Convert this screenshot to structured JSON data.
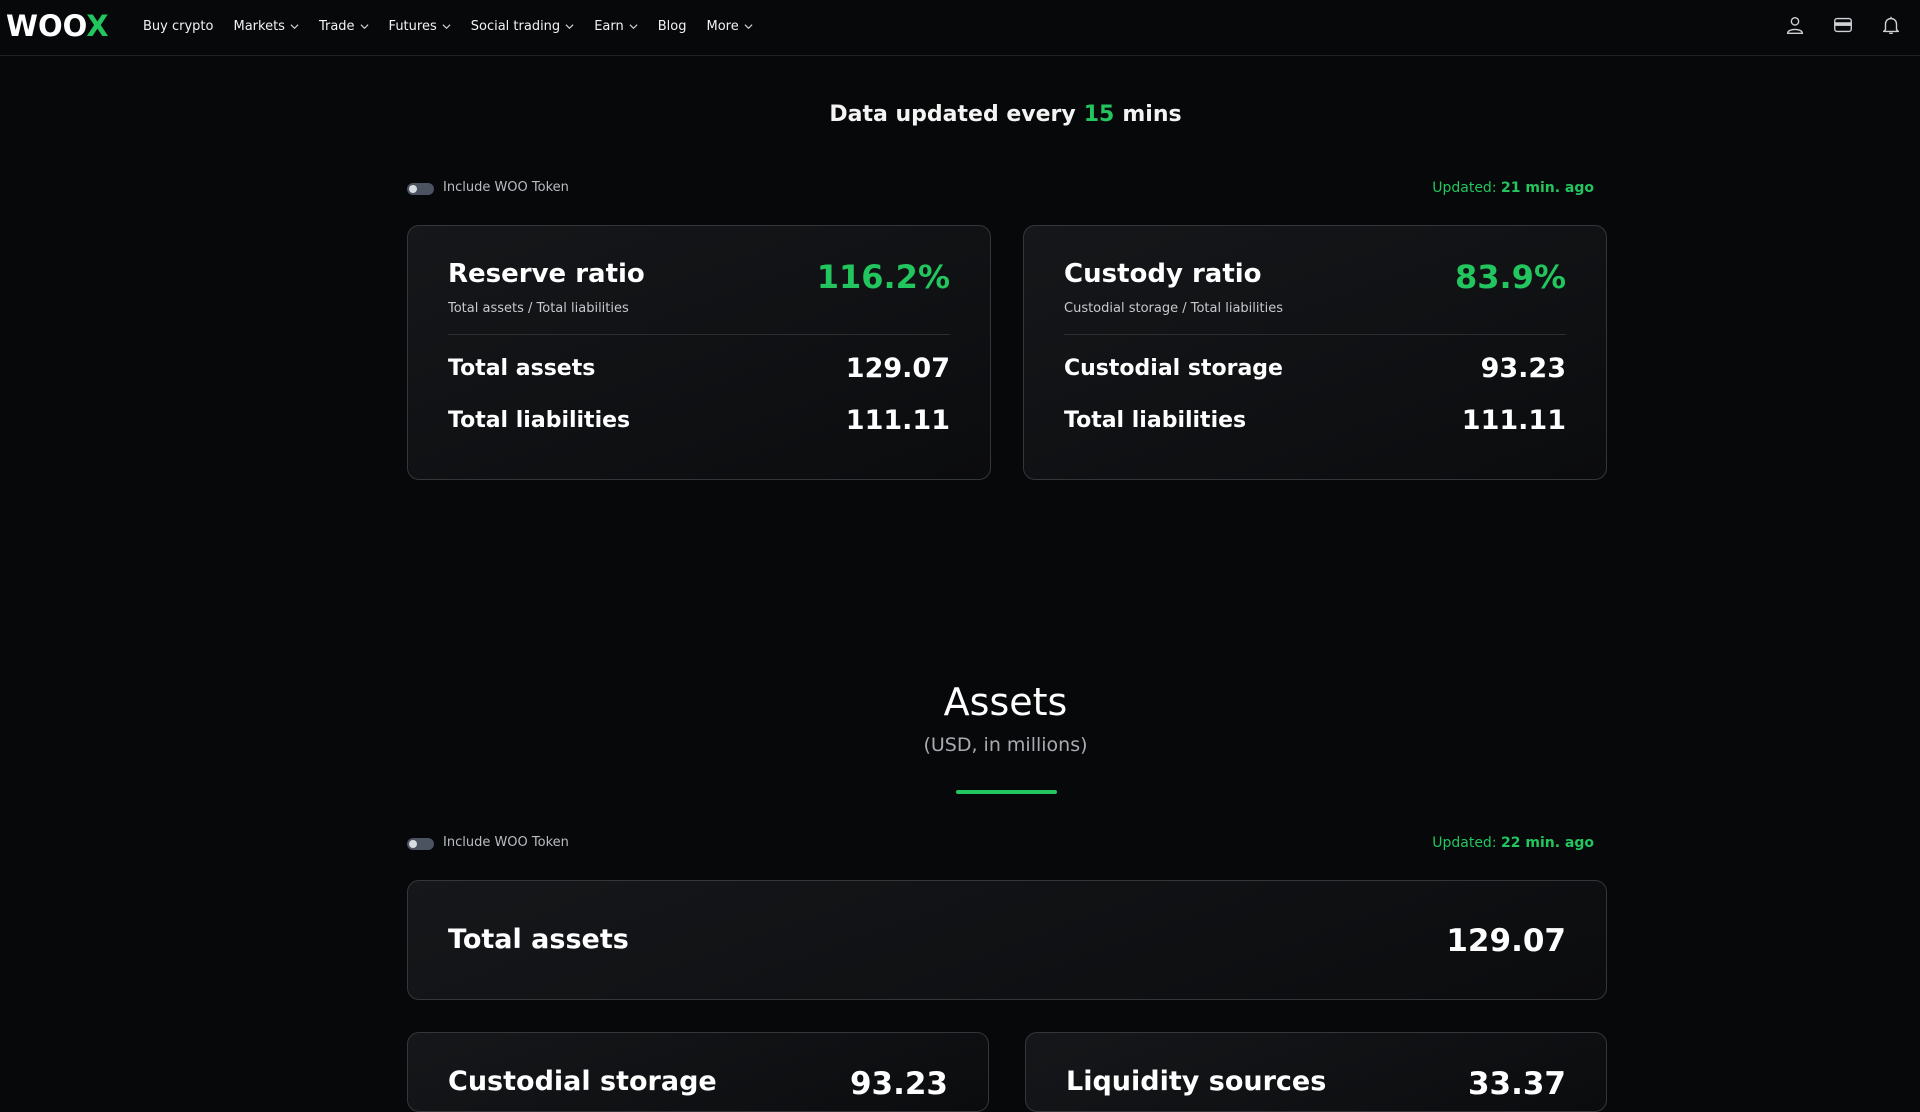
{
  "nav": {
    "logo_main": "WOO",
    "logo_accent": "X",
    "items": [
      {
        "label": "Buy crypto",
        "dropdown": false
      },
      {
        "label": "Markets",
        "dropdown": true
      },
      {
        "label": "Trade",
        "dropdown": true
      },
      {
        "label": "Futures",
        "dropdown": true
      },
      {
        "label": "Social trading",
        "dropdown": true
      },
      {
        "label": "Earn",
        "dropdown": true
      },
      {
        "label": "Blog",
        "dropdown": false
      },
      {
        "label": "More",
        "dropdown": true
      }
    ],
    "icons": [
      "user-icon",
      "wallet-icon",
      "bell-icon"
    ]
  },
  "headline": {
    "prefix": "Data updated every",
    "number": "15",
    "suffix": "mins"
  },
  "reserve_section": {
    "toggle_label": "Include WOO Token",
    "updated_prefix": "Updated:",
    "updated_value": "21 min. ago",
    "cards": [
      {
        "title": "Reserve ratio",
        "subtitle": "Total assets / Total liabilities",
        "ratio": "116.2%",
        "rows": [
          {
            "label": "Total assets",
            "value": "129.07"
          },
          {
            "label": "Total liabilities",
            "value": "111.11"
          }
        ]
      },
      {
        "title": "Custody ratio",
        "subtitle": "Custodial storage / Total liabilities",
        "ratio": "83.9%",
        "rows": [
          {
            "label": "Custodial storage",
            "value": "93.23"
          },
          {
            "label": "Total liabilities",
            "value": "111.11"
          }
        ]
      }
    ]
  },
  "assets_section": {
    "title": "Assets",
    "subtitle": "(USD, in millions)",
    "toggle_label": "Include WOO Token",
    "updated_prefix": "Updated:",
    "updated_value": "22 min. ago",
    "total": {
      "label": "Total assets",
      "value": "129.07"
    },
    "breakdown": [
      {
        "label": "Custodial storage",
        "value": "93.23"
      },
      {
        "label": "Liquidity sources",
        "value": "33.37"
      }
    ]
  },
  "colors": {
    "accent": "#22c55e",
    "background": "#07080a",
    "card_border": "#33363b"
  }
}
